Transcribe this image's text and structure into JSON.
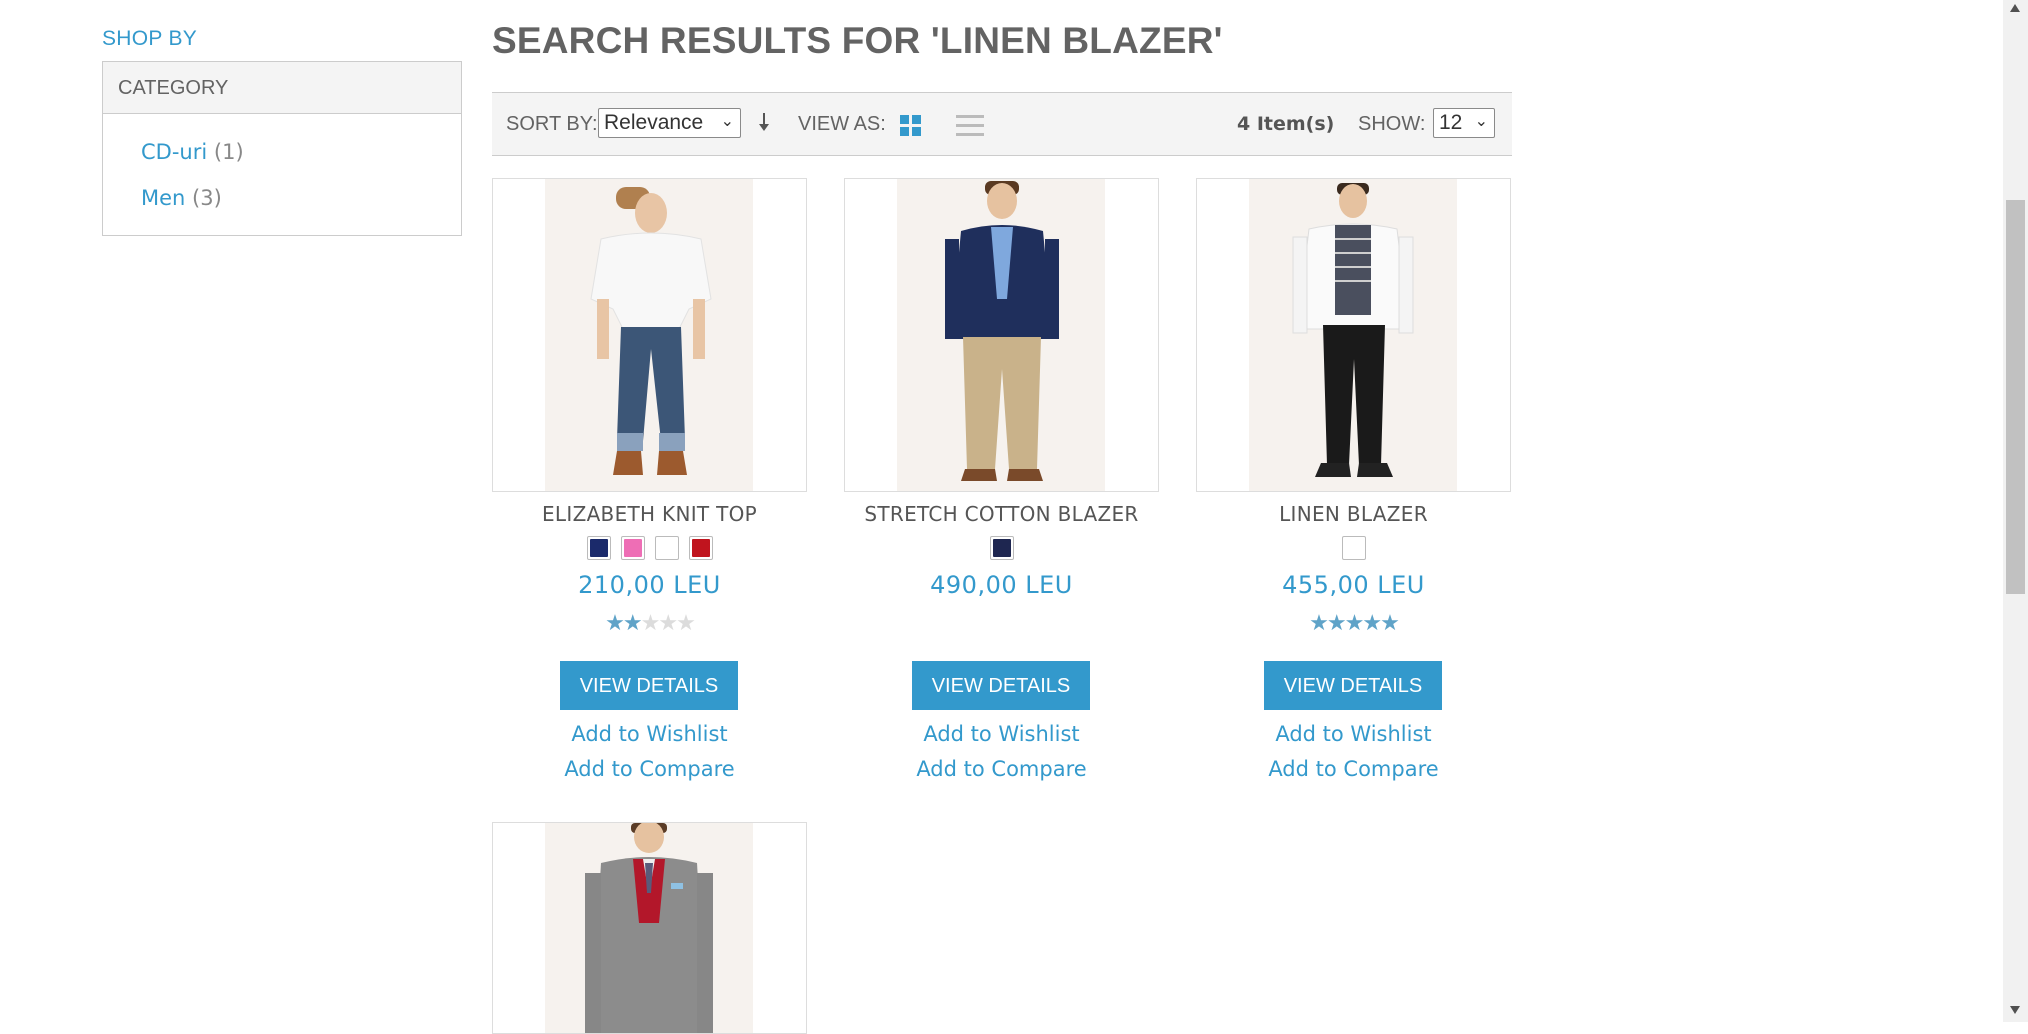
{
  "sidebar": {
    "shop_by": "SHOP BY",
    "category_title": "CATEGORY",
    "categories": [
      {
        "label": "CD-uri",
        "count": "(1)"
      },
      {
        "label": "Men",
        "count": "(3)"
      }
    ]
  },
  "page": {
    "title": "SEARCH RESULTS FOR 'LINEN BLAZER'"
  },
  "toolbar": {
    "sort_by_label": "SORT BY:",
    "sort_value": "Relevance",
    "view_as_label": "VIEW AS:",
    "view_mode": "grid",
    "items_count": "4 Item(s)",
    "show_label": "SHOW:",
    "show_value": "12"
  },
  "products": [
    {
      "name": "ELIZABETH KNIT TOP",
      "price": "210,00 LEU",
      "rating_stars": 2,
      "swatches": [
        "#1b2a6b",
        "#ee6eb5",
        "#ffffff",
        "#c0141e"
      ],
      "button": "VIEW DETAILS",
      "wishlist": "Add to Wishlist",
      "compare": "Add to Compare"
    },
    {
      "name": "STRETCH COTTON BLAZER",
      "price": "490,00 LEU",
      "rating_stars": 0,
      "swatches": [
        "#1e2650"
      ],
      "button": "VIEW DETAILS",
      "wishlist": "Add to Wishlist",
      "compare": "Add to Compare"
    },
    {
      "name": "LINEN BLAZER",
      "price": "455,00 LEU",
      "rating_stars": 5,
      "swatches": [
        "#ffffff"
      ],
      "button": "VIEW DETAILS",
      "wishlist": "Add to Wishlist",
      "compare": "Add to Compare"
    }
  ],
  "colors": {
    "accent": "#3399cc",
    "text": "#636363",
    "toolbar_bg": "#f4f4f4"
  },
  "icons": {
    "sort_direction": "arrow-down-icon",
    "grid_view": "grid-icon",
    "list_view": "list-icon"
  }
}
